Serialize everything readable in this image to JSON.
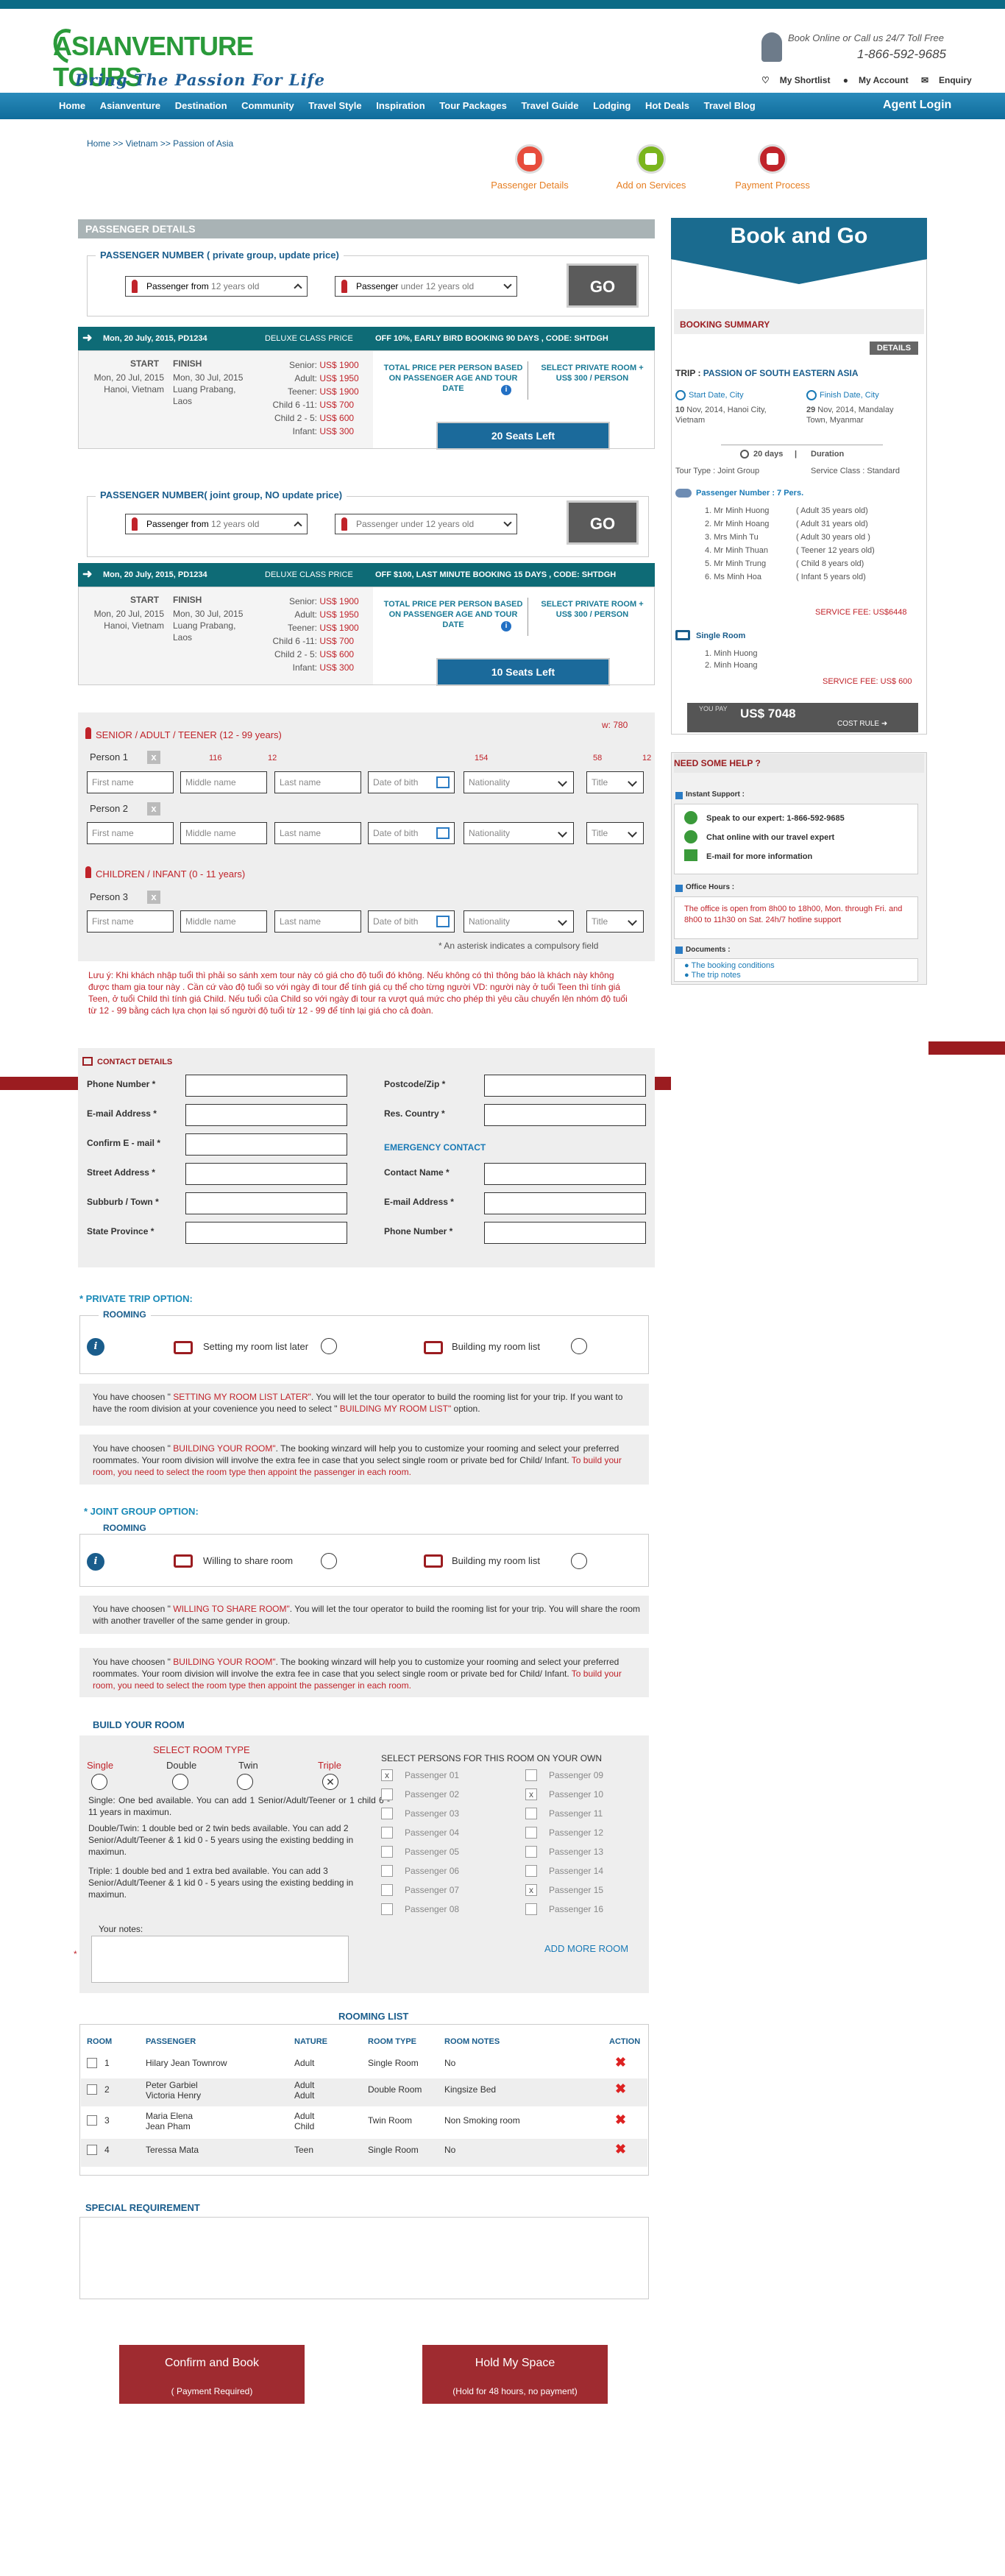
{
  "brand": {
    "logo_main": "ASIANVENTURE TOURS",
    "logo_sub": "Bring The Passion For Life",
    "call_line": "Book Online or Call us 24/7 Toll Free",
    "phone": "1-866-592-9685",
    "links": [
      "My Shortlist",
      "My Account",
      "Enquiry"
    ]
  },
  "nav": {
    "items": [
      "Home",
      "Asianventure",
      "Destination",
      "Community",
      "Travel Style",
      "Inspiration",
      "Tour Packages",
      "Travel Guide",
      "Lodging",
      "Hot Deals",
      "Travel Blog"
    ],
    "agent": "Agent Login"
  },
  "breadcrumb": "Home >>  Vietnam >> Passion of Asia",
  "steps": [
    {
      "label": "Passenger Details",
      "color": "#e74c3c"
    },
    {
      "label": "Add on Services",
      "color": "#7ab51d"
    },
    {
      "label": "Payment Process",
      "color": "#c0232a"
    }
  ],
  "passenger": {
    "section_title": "PASSENGER DETAILS",
    "private_title": "PASSENGER NUMBER ( private group, update price)",
    "from_label": "Passenger from",
    "from_value": "12 years old",
    "under_label": "Passenger",
    "under_value": "under 12 years old",
    "go": "GO",
    "joint_title": "PASSENGER  NUMBER( joint  group, NO update price)",
    "from_label2": "Passenger  from",
    "from_value2": "12 years old",
    "under_label2": "Passenger",
    "under_value2": "under 12 years old"
  },
  "price1": {
    "bar_date": "Mon, 20 July, 2015, PD1234",
    "bar_class": "DELUXE CLASS  PRICE",
    "bar_offer": "OFF 10%, EARLY BIRD BOOKING  90 DAYS , CODE: SHTDGH",
    "start": "START",
    "finish": "FINISH",
    "start_date": "Mon, 20 Jul, 2015",
    "finish_date": "Mon, 30 Jul, 2015",
    "start_place": "Hanoi, Vietnam",
    "finish_place": "Luang Prabang, Laos",
    "rows": [
      {
        "k": "Senior:",
        "v": "US$ 1900"
      },
      {
        "k": "Adult:",
        "v": "US$ 1950"
      },
      {
        "k": "Teener:",
        "v": "US$ 1900"
      },
      {
        "k": "Child 6 -11:",
        "v": "US$ 700"
      },
      {
        "k": "Child 2 - 5:",
        "v": "US$ 600"
      },
      {
        "k": "Infant:",
        "v": "US$ 300"
      }
    ],
    "total_note": "TOTAL  PRICE  PER  PERSON BASED ON PASSENGER AGE AND TOUR DATE",
    "private_room": "SELECT PRIVATE ROOM + US$ 300 / PERSON",
    "seats": "20 Seats Left"
  },
  "price2": {
    "bar_date": "Mon, 20 July, 2015, PD1234",
    "bar_class": "DELUXE CLASS  PRICE",
    "bar_offer": "OFF $100, LAST MINUTE BOOKING  15 DAYS , CODE: SHTDGH",
    "start": "START",
    "finish": "FINISH",
    "start_date": "Mon, 20 Jul, 2015",
    "finish_date": "Mon, 30 Jul, 2015",
    "start_place": "Hanoi, Vietnam",
    "finish_place": "Luang Prabang, Laos",
    "rows": [
      {
        "k": "Senior:",
        "v": "US$ 1900"
      },
      {
        "k": "Adult:",
        "v": "US$ 1950"
      },
      {
        "k": "Teener:",
        "v": "US$ 1900"
      },
      {
        "k": "Child 6 -11:",
        "v": "US$ 700"
      },
      {
        "k": "Child 2 - 5:",
        "v": "US$ 600"
      },
      {
        "k": "Infant:",
        "v": "US$ 300"
      }
    ],
    "total_note": "TOTAL  PRICE  PER  PERSON BASED ON PASSENGER AGE AND TOUR DATE",
    "private_room": "SELECT PRIVATE ROOM + US$ 300 / PERSON",
    "seats": "10 Seats Left"
  },
  "persons": {
    "adult_title": "SENIOR / ADULT / TEENER (12 - 99 years)",
    "width_note": "w: 780",
    "widths": [
      "116",
      "12",
      "154",
      "58",
      "12"
    ],
    "person1": "Person 1",
    "person2": "Person 2",
    "person3": "Person 3",
    "child_title": "CHILDREN / INFANT  (0 - 11 years)",
    "fields": {
      "first": "First name",
      "middle": "Middle name",
      "last": "Last name",
      "dob": "Date of bith",
      "nationality": "Nationality",
      "title": "Title"
    },
    "asterisk": "An asterisk indicates a compulsory field",
    "vn_note": "Lưu ý: Khi khách nhập tuổi thì phải so sánh xem tour này có giá cho độ tuổi đó không. Nếu không có thì thông báo là khách này không  được tham gia tour này . Cần cứ vào độ tuổi so với ngày đi tour để tính giá cụ thể cho từng người VD: người này ở tuổi Teen thì tính giá Teen, ở tuổi Child thì tính giá Child.  Nếu tuổi của Child so với ngày đi tour ra vượt quá mức cho phép thì yêu cầu chuyển lên nhóm độ tuổi từ 12 - 99 bằng cách lựa chọn lại số người độ tuổi từ 12 - 99 để tính lại giá cho cả đoàn."
  },
  "contact": {
    "title": "CONTACT DETAILS",
    "left": [
      "Phone Number *",
      "E-mail Address *",
      "Confirm E - mail *",
      "Street Address *",
      "Subburb / Town *",
      "State Province *"
    ],
    "right": [
      "Postcode/Zip  *",
      "Res. Country *"
    ],
    "emergency_title": "EMERGENCY CONTACT",
    "emergency": [
      "Contact Name  *",
      "E-mail Address *",
      "Phone Number *"
    ]
  },
  "private_trip": {
    "title": "* PRIVATE TRIP  OPTION:",
    "rooming": "ROOMING",
    "opt1": "Setting my room list later",
    "opt2": "Building my room list",
    "note1_a": "You have choosen \"",
    "note1_b": " SETTING MY ROOM LIST LATER\"",
    "note1_c": ". You  will let  the  tour operator to build the rooming list for your trip.  If  you want to have the room division at your covenience you need to select \"",
    "note1_d": " BUILDING MY ROOM LIST\"",
    "note1_e": "  option.",
    "note2_a": "You have choosen \"",
    "note2_b": " BUILDING YOUR ROOM\"",
    "note2_c": ". The booking winzard will help you to customize your rooming and select your preferred roommates. Your room division will involve the extra fee in case that you select  single room or private bed for Child/ Infant.",
    "note2_d": " To build your room,  you need to select  the room type then appoint the passenger in each room."
  },
  "joint_group": {
    "title": "* JOINT GROUP OPTION:",
    "rooming": "ROOMING",
    "opt1": "Willing to share room",
    "opt2": "Building my room list",
    "note1_a": "You have choosen \"",
    "note1_b": " WILLING TO SHARE ROOM\"",
    "note1_c": ". You  will let  the tour operator to build the rooming list for your trip.  You  will share the room  with another traveller of  the same gender  in group.",
    "note2_a": "You have choosen \"",
    "note2_b": " BUILDING YOUR ROOM\"",
    "note2_c": ". The booking winzard will help you to customize your rooming and select your preferred roommates. Your room division will involve the extra fee in case that you select  single room or private bed for Child/ Infant.",
    "note2_d": " To build your room,  you need to select  the room type then appoint the passenger in each room."
  },
  "build": {
    "title": "BUILD YOUR ROOM",
    "room_type_title": "SELECT ROOM TYPE",
    "types": [
      "Single",
      "Double",
      "Twin",
      "Triple"
    ],
    "desc1": "Single:  One  bed  available.  You  can  add  1 Senior/Adult/Teener or 1 child 6 - 11 years in maximun.",
    "desc2": "Double/Twin: 1 double bed or 2 twin beds available. You can add 2  Senior/Adult/Teener & 1 kid 0 - 5 years  using the existing bedding in maximun.",
    "desc3": "Triple: 1 double bed and 1 extra bed available. You can add 3 Senior/Adult/Teener & 1 kid 0 - 5 years using the existing bedding in maximun.",
    "persons_title": "SELECT  PERSONS FOR THIS ROOM ON YOUR OWN",
    "passengers_left": [
      "Passenger 01",
      "Passenger 02",
      "Passenger 03",
      "Passenger 04",
      "Passenger 05",
      "Passenger 06",
      "Passenger 07",
      "Passenger 08"
    ],
    "passengers_right": [
      "Passenger 09",
      "Passenger 10",
      "Passenger 11",
      "Passenger 12",
      "Passenger 13",
      "Passenger 14",
      "Passenger 15",
      "Passenger 16"
    ],
    "notes_label": "Your notes:",
    "add_more": "ADD MORE ROOM"
  },
  "rooming_list": {
    "title": "ROOMING  LIST",
    "headers": [
      "ROOM",
      "PASSENGER",
      "NATURE",
      "ROOM  TYPE",
      "ROOM NOTES",
      "ACTION"
    ],
    "rows": [
      {
        "num": "1",
        "p1": "Hilary  Jean  Townrow",
        "p2": "",
        "n1": "Adult",
        "n2": "",
        "type": "Single Room",
        "notes": "No"
      },
      {
        "num": "2",
        "p1": "Peter Garbiel",
        "p2": "Victoria Henry",
        "n1": "Adult",
        "n2": "Adult",
        "type": "Double Room",
        "notes": "Kingsize Bed"
      },
      {
        "num": "3",
        "p1": "Maria Elena",
        "p2": "Jean Pham",
        "n1": "Adult",
        "n2": "Child",
        "type": "Twin  Room",
        "notes": "Non Smoking room"
      },
      {
        "num": "4",
        "p1": "Teressa Mata",
        "p2": "",
        "n1": "Teen",
        "n2": "",
        "type": "Single  Room",
        "notes": "No"
      }
    ]
  },
  "special": {
    "title": "SPECIAL REQUIREMENT"
  },
  "actions": {
    "confirm": "Confirm and Book",
    "confirm_sub": "( Payment Required)",
    "hold": "Hold My Space",
    "hold_sub": "(Hold for 48 hours, no payment)"
  },
  "sidebar": {
    "book_go": "Book and Go",
    "summary_title": "BOOKING SUMMARY",
    "details": "DETAILS",
    "trip_label": "TRIP :",
    "trip_name": "PASSION OF SOUTH EASTERN ASIA",
    "start_label": "Start Date, City",
    "finish_label": "Finish Date, City",
    "start_val_a": "10",
    "start_val_b": " Nov, 2014, Hanoi City, Vietnam",
    "finish_val_a": "29",
    "finish_val_b": " Nov, 2014, Mandalay Town, Myanmar",
    "days": "20 days",
    "duration": "Duration",
    "tour_type": "Tour Type : Joint Group",
    "service_class": "Service Class :  Standard",
    "pax_title": "Passenger Number : 7 Pers.",
    "pax": [
      {
        "n": "1.  Mr Minh  Huong",
        "a": "( Adult  35 years old)"
      },
      {
        "n": "2.  Mr Minh Hoang",
        "a": "( Adult  31 years old)"
      },
      {
        "n": "3.  Mrs Minh  Tu",
        "a": "( Adult 30 years old )"
      },
      {
        "n": "4.  Mr Minh Thuan",
        "a": "( Teener  12 years old)"
      },
      {
        "n": "5.  Mr Minh  Trung",
        "a": "( Child 8 years old)"
      },
      {
        "n": "6.  Ms Minh Hoa",
        "a": "( Infant 5 years old)"
      }
    ],
    "service_fee1": "SERVICE FEE: US$6448",
    "single_room": "Single Room",
    "room_pax": [
      "1.  Minh  Huong",
      "2.  Minh Hoang"
    ],
    "service_fee2": "SERVICE FEE: US$ 600",
    "you_pay": "YOU PAY",
    "pay_val": "US$ 7048",
    "cost_rule": "COST RULE",
    "help_title": "NEED SOME HELP ?",
    "instant": "Instant Support :",
    "speak": "Speak to our expert: 1-866-592-9685",
    "chat": "Chat online with our travel expert",
    "email": "E-mail for more  information",
    "office": "Office Hours :",
    "office_text": "The office  is open from 8h00 to 18h00, Mon.  through Fri. and 8h00 to 11h30 on  Sat.  24h/7 hotline  support",
    "docs": "Documents :",
    "doc_links": [
      "The booking conditions",
      "The trip notes"
    ]
  }
}
